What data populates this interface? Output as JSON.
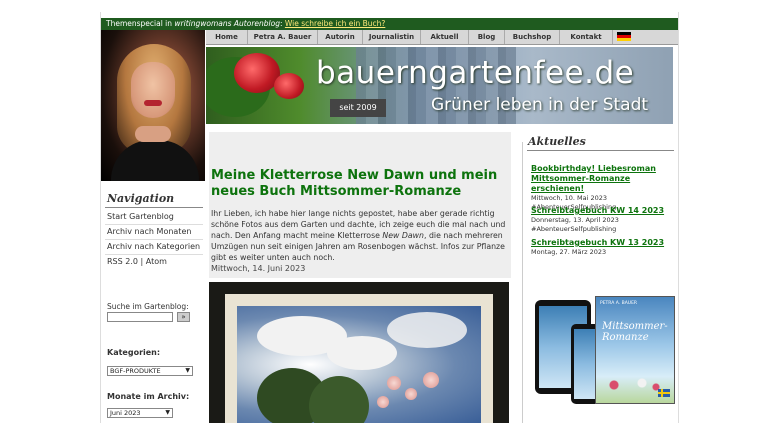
{
  "topbar": {
    "prefix": "Themenspecial in ",
    "blog": "writingwomans Autorenblog",
    "colon": ":",
    "link": "Wie schreibe ich ein Buch?"
  },
  "navbar": {
    "items": [
      {
        "label": "Home"
      },
      {
        "label": "Petra A. Bauer"
      },
      {
        "label": "Autorin"
      },
      {
        "label": "Journalistin"
      },
      {
        "label": "Aktuell"
      },
      {
        "label": "Blog"
      },
      {
        "label": "Buchshop"
      },
      {
        "label": "Kontakt"
      }
    ],
    "flag_colors": [
      "#000000",
      "#dd0000",
      "#ffce00"
    ]
  },
  "header": {
    "title": "bauerngartenfee.de",
    "subtitle": "Grüner leben in der Stadt",
    "since": "seit 2009"
  },
  "sidebar": {
    "nav_heading": "Navigation",
    "links": [
      {
        "label": "Start Gartenblog"
      },
      {
        "label": "Archiv nach Monaten"
      },
      {
        "label": "Archiv nach Kategorien"
      },
      {
        "label": "RSS 2.0 | Atom"
      }
    ],
    "search_label": "Suche im Gartenblog:",
    "search_button": "»",
    "categories_label": "Kategorien:",
    "categories_selected": "BGF-PRODUKTE",
    "archive_label": "Monate im Archiv:",
    "archive_selected": "Juni 2023"
  },
  "post": {
    "title": "Meine Kletterrose New Dawn und mein neues Buch Mittsommer-Romanze",
    "intro_before": "Ihr Lieben, ich habe hier lange nichts gepostet, habe aber gerade richtig schöne Fotos aus dem Garten und dachte, ich zeige euch die mal nach und nach. Den Anfang macht meine Kletterrose ",
    "intro_em": "New Dawn",
    "intro_after": ", die nach mehreren Umzügen nun seit einigen Jahren am Rosenbogen wächst. Infos zur Pflanze gibt es weiter unten auch noch.",
    "date": "Mittwoch, 14. Juni 2023"
  },
  "aktuelles": {
    "heading": "Aktuelles",
    "items": [
      {
        "title": "Bookbirthday! Liebesroman Mittsommer-Romanze erschienen!",
        "date": "Mittwoch, 10. Mai 2023",
        "tag": "#AbenteuerSelfpublishing"
      },
      {
        "title": "Schreibtagebuch KW 14 2023",
        "date": "Donnerstag, 13. April 2023",
        "tag": "#AbenteuerSelfpublishing"
      },
      {
        "title": "Schreibtagebuch KW 13 2023",
        "date": "Montag, 27. März 2023",
        "tag": ""
      }
    ],
    "book": {
      "title_line1": "Mittsommer-",
      "title_line2": "Romanze",
      "author": "PETRA A. BAUER"
    }
  },
  "colors": {
    "green_dark": "#1f5b1f",
    "title_green": "#0d730d",
    "link_yellow": "#ffe97a"
  }
}
